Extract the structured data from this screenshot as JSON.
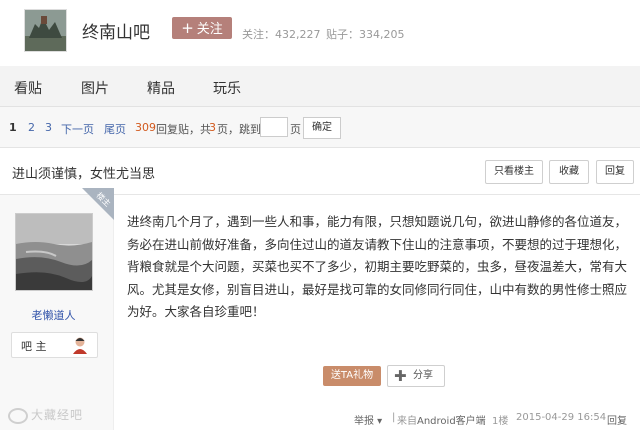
{
  "header": {
    "forum_name": "终南山吧",
    "follow_label": "关注",
    "follow_count": "关注：432,227",
    "post_count": "贴子：334,205"
  },
  "nav": {
    "tabs": [
      "看贴",
      "图片",
      "精品",
      "玩乐"
    ]
  },
  "pager": {
    "pages": [
      "1",
      "2",
      "3"
    ],
    "current_page": "1",
    "next_label": "下一页",
    "last_label": "尾页",
    "reply_count": "309",
    "reply_label": "回复贴，共",
    "total_pages": "3",
    "pages_suffix": "页，跳到",
    "page_unit": "页",
    "confirm_label": "确定"
  },
  "thread": {
    "title": "进山须谨慎，女性尤当思",
    "only_owner_label": "只看楼主",
    "collect_label": "收藏",
    "reply_label": "回复"
  },
  "post": {
    "lz_label": "楼主",
    "author": "老懒道人",
    "owner_label": "吧 主",
    "content": "进终南几个月了，遇到一些人和事，能力有限，只想知题说几句，欲进山静修的各位道友，务必在进山前做好准备，多向住过山的道友请教下住山的注意事项，不要想的过于理想化，背粮食就是个大问题，买菜也买不了多少，初期主要吃野菜的，虫多，昼夜温差大，常有大风。尤其是女修，别盲目进山，最好是找可靠的女同修同行同住，山中有数的男性修士照应为好。大家各自珍重吧！",
    "gift_label": "送TA礼物",
    "share_label": "分享",
    "report_label": "举报",
    "source": "来自Android客户端",
    "floor": "1楼",
    "time": "2015-04-29 16:54",
    "reply_label": "回复"
  },
  "watermark": "大藏经吧",
  "colors": {
    "follow_button": "#b5807a",
    "gift_button": "#c98c6a",
    "link": "#4466aa",
    "highlight": "#d25a1e",
    "lz_badge": "#aab4c0"
  },
  "icons": [
    "forum-logo",
    "plus-icon",
    "lz-ribbon",
    "owner-icon",
    "share-plus-icon",
    "watermark-logo"
  ]
}
